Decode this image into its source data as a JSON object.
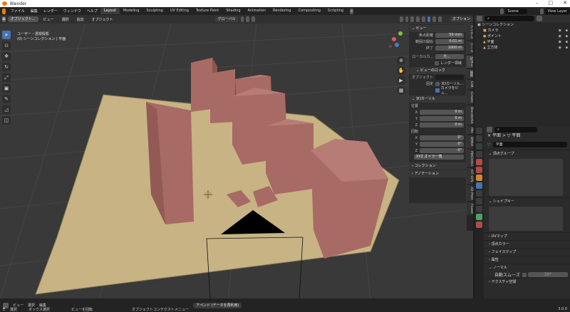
{
  "window": {
    "title": "Blender"
  },
  "menubar": [
    "ファイル",
    "編集",
    "レンダー",
    "ウィンドウ",
    "ヘルプ"
  ],
  "workspace_tabs": [
    "Layout",
    "Modeling",
    "Sculpting",
    "UV Editing",
    "Texture Paint",
    "Shading",
    "Animation",
    "Rendering",
    "Compositing",
    "Scripting"
  ],
  "active_tab": "Layout",
  "scene": {
    "label": "Scene",
    "view_layer": "View Layer"
  },
  "viewport_header": {
    "mode": "オブジェクト...",
    "menus": [
      "ビュー",
      "選択",
      "追加",
      "オブジェクト"
    ],
    "transform": "グローバル",
    "options": "オプション"
  },
  "viewport_info": {
    "line1": "ユーザー・透視投影",
    "line2": "(0) シーンコレクション | 平面"
  },
  "npanel": {
    "view_title": "ビュー",
    "focal_label": "焦点距離",
    "focal_value": "50 mm",
    "clip_start_label": "範囲の開始",
    "clip_start_value": "0.01 m",
    "clip_end_label": "終了",
    "clip_end_value": "1000 m",
    "local_camera_label": "ローカルカ...",
    "local_camera_value": "カ...",
    "render_region_label": "レンダー領域",
    "view_lock_title": "ビューのロック",
    "object_label": "オブジェクト",
    "lock_label": "固定",
    "lock_3d_cursor": "3Dカーソル...",
    "camera_to_view": "カメラをビュ...",
    "cursor_title": "3Dカーソル",
    "location_label": "位置",
    "rotation_label": "回転",
    "x": "X",
    "y": "Y",
    "z": "Z",
    "loc_x": "0 m",
    "loc_y": "0 m",
    "loc_z": "0 m",
    "rot_x": "0°",
    "rot_y": "0°",
    "rot_z": "0°",
    "euler_mode": "XYZ オイラー角",
    "collection_title": "コレクション",
    "annotation_title": "アノテーション"
  },
  "side_tabs": [
    "アイテム",
    "ツール",
    "ビュー",
    "編集",
    "Edit",
    "Create",
    "BlenderKit",
    "MH",
    "BMAX",
    "MACHIN3",
    "KIT OPS",
    "3D-Print",
    "Fluent"
  ],
  "outliner": {
    "root": "シーンコレクション",
    "items": [
      {
        "name": "カメラ",
        "color": "#d7a24a"
      },
      {
        "name": "ポイント",
        "color": "#d7a24a"
      },
      {
        "name": "平面",
        "color": "#d7a24a"
      },
      {
        "name": "立方体",
        "color": "#d7a24a"
      }
    ]
  },
  "properties": {
    "object_name": "平面",
    "mesh_name": "平面",
    "sections": [
      "頂点グループ",
      "シェイプキー",
      "UVマップ",
      "頂点カラー",
      "フェイスマップ",
      "属性",
      "ノーマル",
      "テクスチャ空間"
    ],
    "autosmooth_label": "自動スムーズ",
    "autosmooth_value": "30°"
  },
  "statusbar": {
    "menus": [
      "ビュー",
      "選択",
      "編集"
    ],
    "hint1": "選択",
    "hint2": "ボックス選択",
    "hint3": "ビューを回転",
    "hint4": "オブジェクトコンテクストメニュー",
    "append": "アペンド (データを再利用)",
    "version": "3.0.0"
  },
  "colors": {
    "accent": "#4772b3",
    "box_fill": "#a86a64",
    "floor": "#c7b384",
    "grid": "#4a4a4a"
  }
}
